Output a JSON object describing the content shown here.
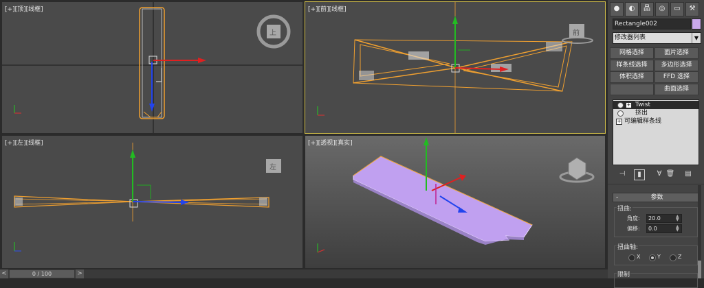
{
  "viewports": {
    "top": {
      "label": "[+][顶][线框]"
    },
    "front": {
      "label": "[+][前][线框]"
    },
    "left": {
      "label": "[+][左][线框]"
    },
    "perspective": {
      "label": "[+][透视][真实]"
    }
  },
  "viewcube": {
    "top_face": "上",
    "front_face": "前",
    "left_face": "左"
  },
  "timeline": {
    "frame": "0 / 100",
    "prev": "<",
    "next": ">"
  },
  "panel": {
    "tabs": [
      "create-icon",
      "modify-icon",
      "hierarchy-icon",
      "motion-icon",
      "display-icon",
      "utilities-icon"
    ],
    "object_name": "Rectangle002",
    "object_color": "#c9a8ea",
    "modifier_list": "修改器列表",
    "modifier_buttons": [
      "网格选择",
      "面片选择",
      "样条线选择",
      "多边形选择",
      "体积选择",
      "FFD 选择",
      "曲面选择"
    ],
    "stack": [
      "Twist",
      "挤出",
      "可编辑样条线"
    ],
    "rollout_title": "参数",
    "twist_group": "扭曲:",
    "angle_label": "角度:",
    "angle_value": "20.0",
    "bias_label": "偏移:",
    "bias_value": "0.0",
    "axis_group": "扭曲轴:",
    "axes": [
      "X",
      "Y",
      "Z"
    ],
    "selected_axis": "Y",
    "limits_group": "限制"
  }
}
